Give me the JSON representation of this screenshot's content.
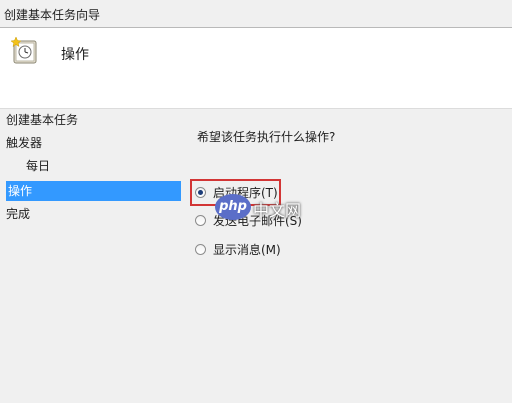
{
  "window": {
    "title": "创建基本任务向导"
  },
  "header": {
    "heading": "操作",
    "icon": "task-scheduler-clock-icon"
  },
  "sidebar": {
    "items": [
      {
        "label": "创建基本任务",
        "active": false
      },
      {
        "label": "触发器",
        "active": false
      },
      {
        "label": "每日",
        "active": false
      },
      {
        "label": "操作",
        "active": true
      },
      {
        "label": "完成",
        "active": false
      }
    ]
  },
  "main": {
    "prompt": "希望该任务执行什么操作?",
    "options": [
      {
        "label": "启动程序(T)",
        "selected": true
      },
      {
        "label": "发送电子邮件(S)",
        "selected": false
      },
      {
        "label": "显示消息(M)",
        "selected": false
      }
    ]
  },
  "watermark": {
    "text": "php中文网"
  },
  "colors": {
    "selection": "#3399ff",
    "highlight_border": "#d23535"
  }
}
